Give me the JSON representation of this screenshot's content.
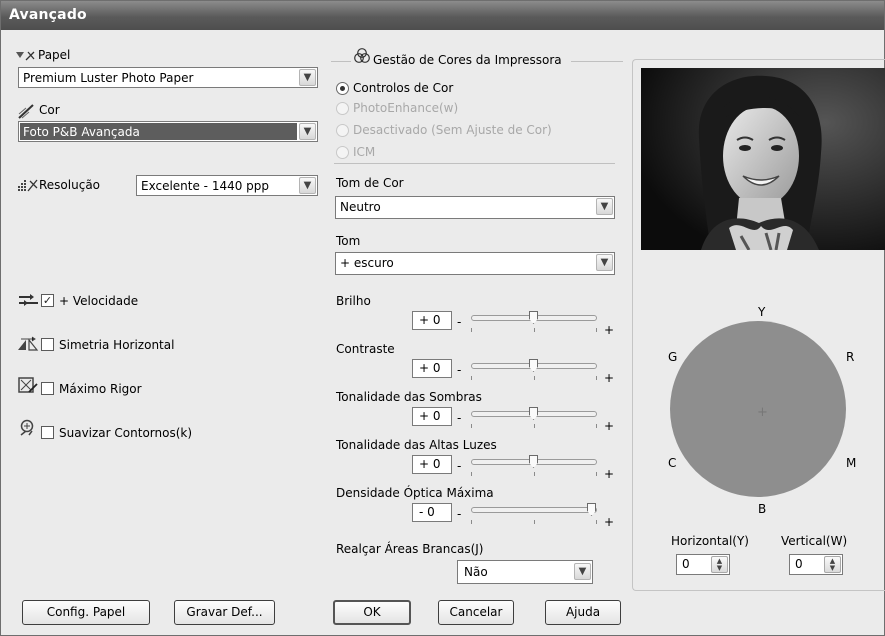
{
  "window": {
    "title": "Avançado"
  },
  "left": {
    "paper": {
      "label": "Papel",
      "value": "Premium Luster Photo Paper"
    },
    "color": {
      "label": "Cor",
      "value": "Foto P&B Avançada"
    },
    "resolution": {
      "label": "Resolução",
      "value": "Excelente - 1440 ppp"
    },
    "options": [
      {
        "label": "+ Velocidade",
        "checked": true
      },
      {
        "label": "Simetria Horizontal",
        "checked": false
      },
      {
        "label": "Máximo Rigor",
        "checked": false
      },
      {
        "label": "Suavizar Contornos(k)",
        "checked": false
      }
    ]
  },
  "color_management": {
    "title": "Gestão de Cores da Impressora",
    "modes": [
      {
        "label": "Controlos de Cor",
        "selected": true,
        "enabled": true
      },
      {
        "label": "PhotoEnhance(w)",
        "selected": false,
        "enabled": false
      },
      {
        "label": "Desactivado (Sem Ajuste de Cor)",
        "selected": false,
        "enabled": false
      },
      {
        "label": "ICM",
        "selected": false,
        "enabled": false
      }
    ],
    "tone_color": {
      "label": "Tom de Cor",
      "value": "Neutro"
    },
    "tone": {
      "label": "Tom",
      "value": "+ escuro"
    },
    "sliders": [
      {
        "label": "Brilho",
        "value": "+ 0",
        "level": 0.5
      },
      {
        "label": "Contraste",
        "value": "+ 0",
        "level": 0.5
      },
      {
        "label": "Tonalidade das Sombras",
        "value": "+ 0",
        "level": 0.5
      },
      {
        "label": "Tonalidade das Altas Luzes",
        "value": "+ 0",
        "level": 0.5
      },
      {
        "label": "Densidade Óptica Máxima",
        "value": "- 0",
        "level": 1.0
      }
    ],
    "slider_minus": "-",
    "slider_plus": "+",
    "highlight_whites": {
      "label": "Realçar Áreas Brancas(J)",
      "value": "Não"
    }
  },
  "preview": {
    "wheel": {
      "Y": "Y",
      "R": "R",
      "M": "M",
      "B": "B",
      "C": "C",
      "G": "G",
      "center": "+"
    },
    "wheel_color": "#8e8e8e",
    "horizontal": {
      "label": "Horizontal(Y)",
      "value": "0"
    },
    "vertical": {
      "label": "Vertical(W)",
      "value": "0"
    }
  },
  "buttons": {
    "config_paper": "Config. Papel",
    "save_defaults": "Gravar Def...",
    "ok": "OK",
    "cancel": "Cancelar",
    "help": "Ajuda"
  }
}
